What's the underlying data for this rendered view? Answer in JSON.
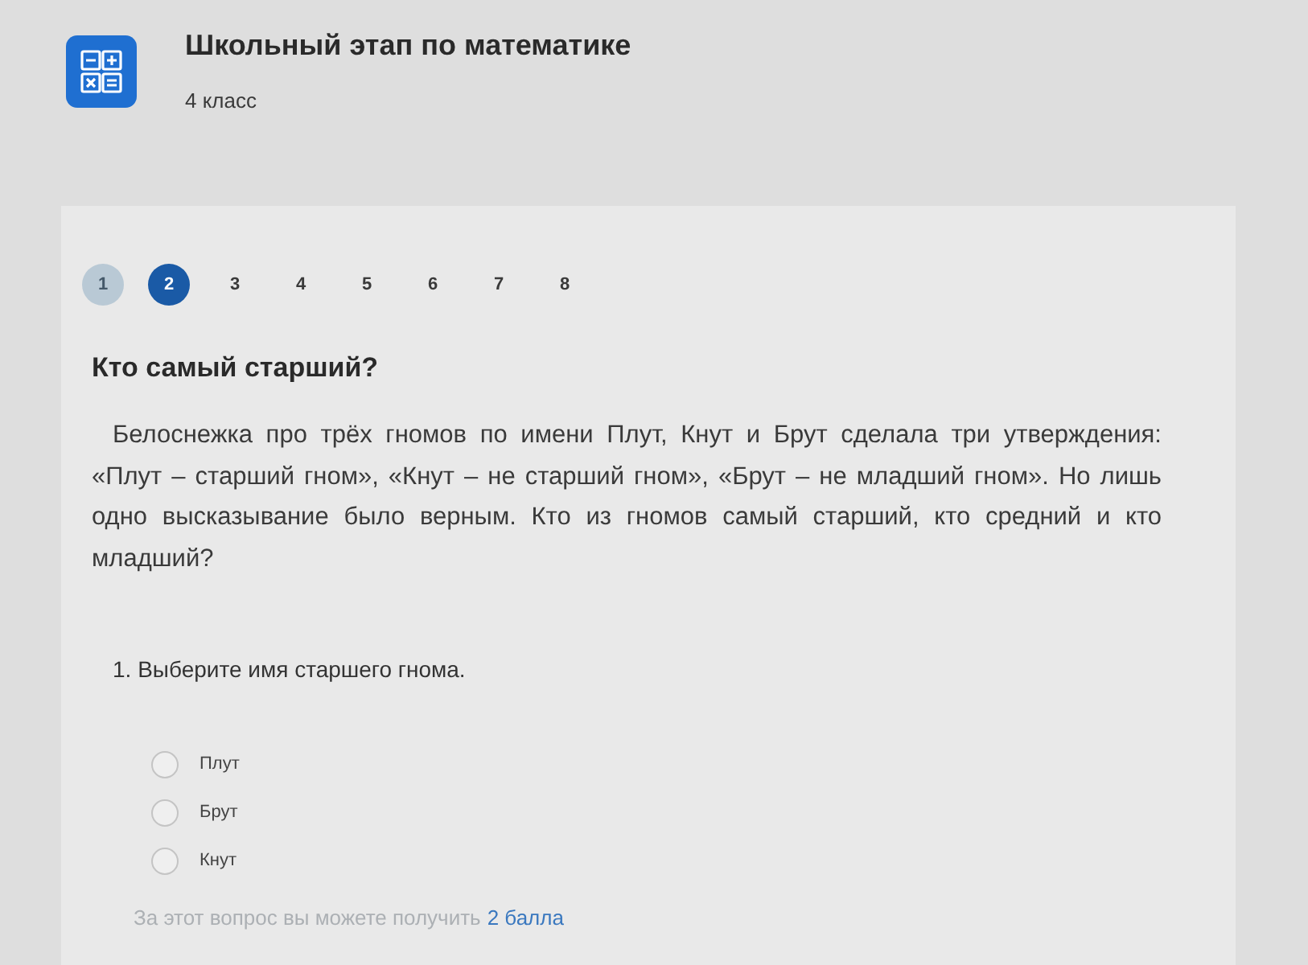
{
  "header": {
    "title": "Школьный этап по математике",
    "subtitle": "4 класс"
  },
  "pager": [
    {
      "label": "1",
      "selected": false,
      "answered": true
    },
    {
      "label": "2",
      "selected": true,
      "answered": false
    },
    {
      "label": "3",
      "selected": false,
      "answered": false
    },
    {
      "label": "4",
      "selected": false,
      "answered": false
    },
    {
      "label": "5",
      "selected": false,
      "answered": false
    },
    {
      "label": "6",
      "selected": false,
      "answered": false
    },
    {
      "label": "7",
      "selected": false,
      "answered": false
    },
    {
      "label": "8",
      "selected": false,
      "answered": false
    }
  ],
  "question": {
    "title": "Кто самый старший?",
    "text": "Белоснежка про трёх гномов по имени Плут, Кнут и Брут сделала три утверждения: «Плут – старший гном», «Кнут – не старший гном», «Брут – не младший гном». Но лишь одно высказывание было верным. Кто из гномов самый старший, кто средний и кто младший?"
  },
  "subquestion": {
    "prompt": "1. Выберите имя старшего гнома.",
    "options": [
      {
        "label": "Плут",
        "selected": false
      },
      {
        "label": "Брут",
        "selected": false
      },
      {
        "label": "Кнут",
        "selected": false
      }
    ]
  },
  "footer": {
    "text": "За этот вопрос вы можете получить",
    "points": "2 балла"
  }
}
